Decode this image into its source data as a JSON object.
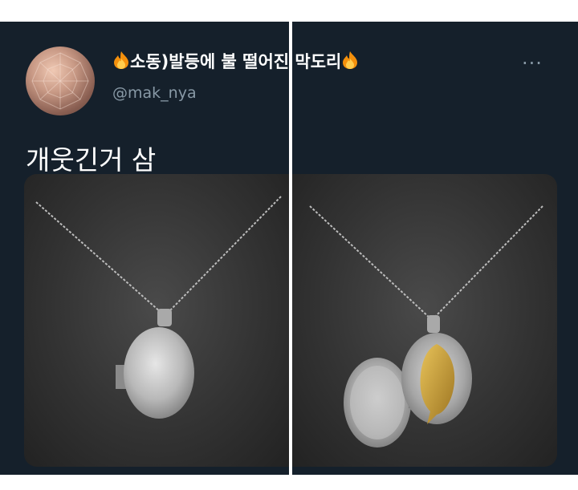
{
  "tweet": {
    "display_name": "소동)발등에 불 떨어진 막도리",
    "handle": "@mak_nya",
    "text": "개웃긴거 삼",
    "more_label": "···"
  },
  "icons": {
    "fire": "fire-emoji-icon",
    "more": "more-options-icon"
  },
  "colors": {
    "background": "#15202b",
    "text": "#ffffff",
    "secondary_text": "#8899a6",
    "locket_silver": "#c7c7c7",
    "fish_gold": "#c9a238"
  }
}
